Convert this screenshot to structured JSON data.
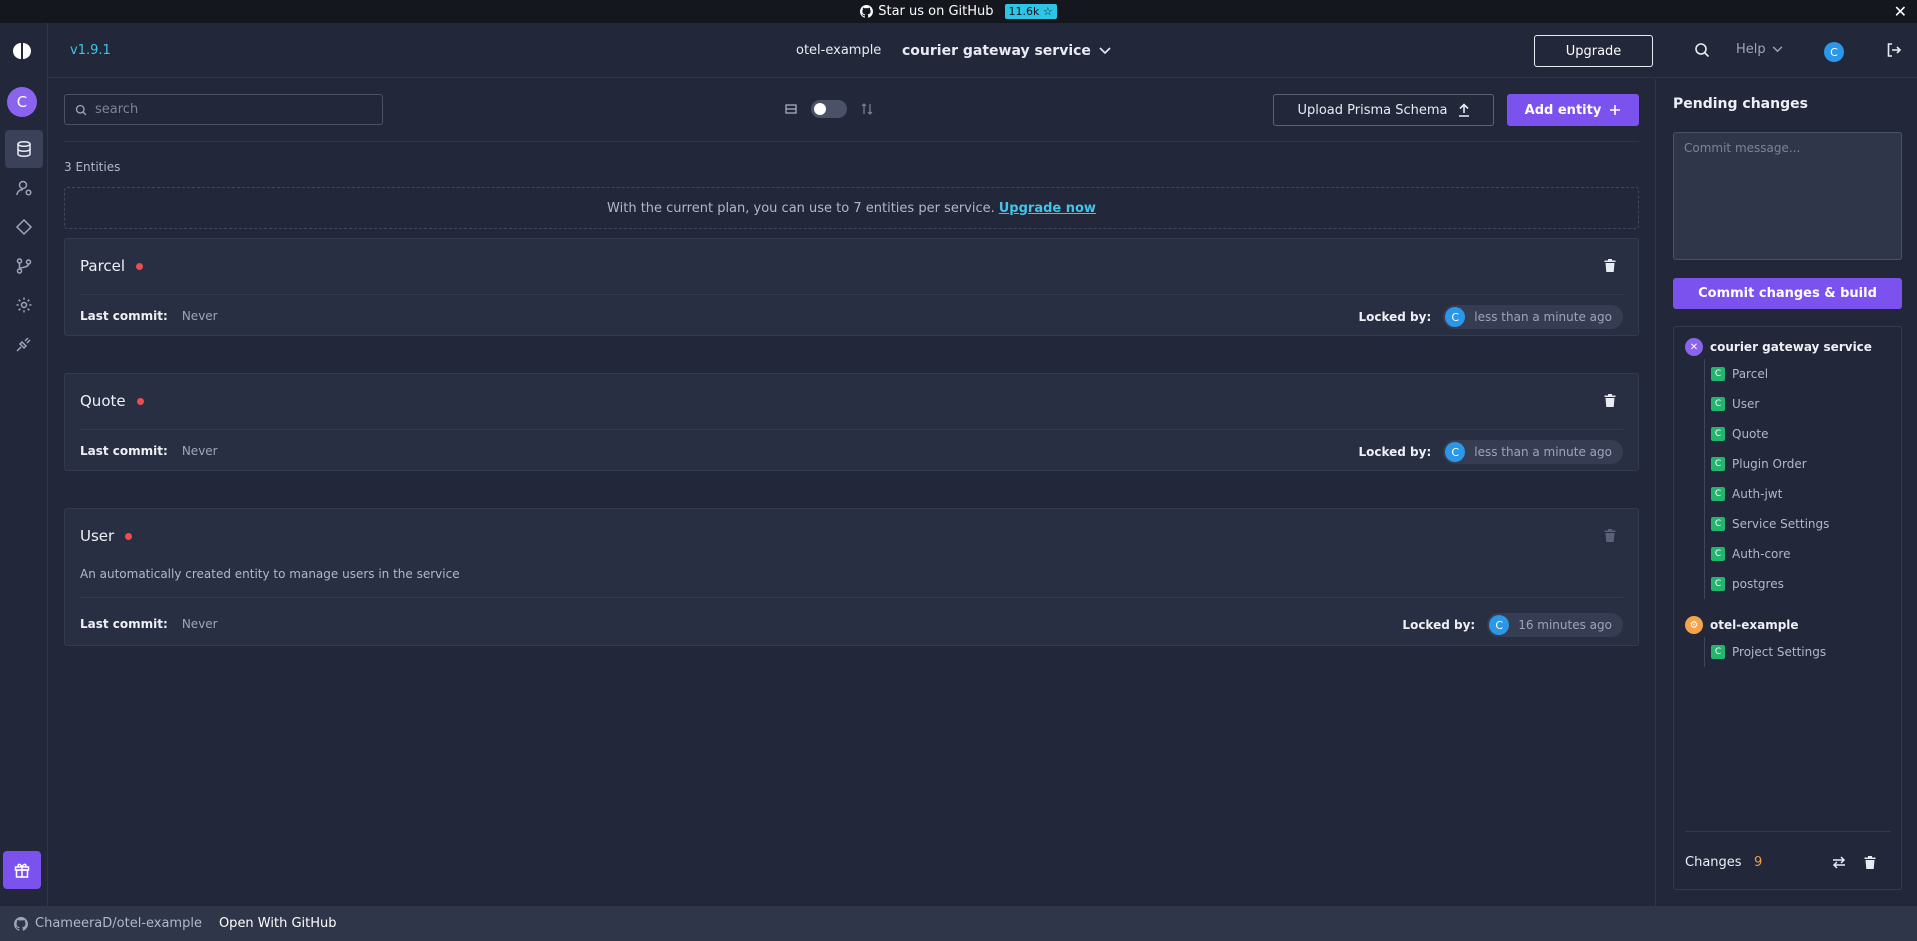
{
  "banner": {
    "text": "Star us on GitHub",
    "stars": "11.6k ☆",
    "close": "✕"
  },
  "header": {
    "version": "v1.9.1",
    "project": "otel-example",
    "service": "courier gateway service",
    "upgrade": "Upgrade",
    "help": "Help",
    "avatar_initial": "C"
  },
  "rail": {
    "avatar_initial": "C",
    "items": [
      "entities",
      "roles",
      "plugins",
      "commits",
      "settings",
      "connections"
    ]
  },
  "main": {
    "search_placeholder": "search",
    "upload_label": "Upload Prisma Schema",
    "add_label": "Add entity",
    "entity_count": "3 Entities",
    "plan_note": "With the current plan, you can use to 7 entities per service.",
    "plan_link": "Upgrade now",
    "commit_label": "Last commit:",
    "locked_label": "Locked by:",
    "entities": [
      {
        "name": "Parcel",
        "description": "",
        "last_commit": "Never",
        "locked_initial": "C",
        "locked_time": "less than a minute ago"
      },
      {
        "name": "Quote",
        "description": "",
        "last_commit": "Never",
        "locked_initial": "C",
        "locked_time": "less than a minute ago"
      },
      {
        "name": "User",
        "description": "An automatically created entity to manage users in the service",
        "last_commit": "Never",
        "locked_initial": "C",
        "locked_time": "16 minutes ago"
      }
    ]
  },
  "panel": {
    "title": "Pending changes",
    "commit_placeholder": "Commit message...",
    "commit_button": "Commit changes & build",
    "groups": [
      {
        "title": "courier gateway service",
        "color": "#8a63ef",
        "items": [
          "Parcel",
          "User",
          "Quote",
          "Plugin Order",
          "Auth-jwt",
          "Service Settings",
          "Auth-core",
          "postgres"
        ]
      },
      {
        "title": "otel-example",
        "color": "#f5a34a",
        "items": [
          "Project Settings"
        ]
      }
    ],
    "badge_letter": "C",
    "changes_label": "Changes",
    "changes_count": "9"
  },
  "bottombar": {
    "repo": "ChameeraD/otel-example",
    "open": "Open With GitHub"
  },
  "colors": {
    "accent": "#7b52ee",
    "link": "#42c3e8",
    "status_red": "#ec4d4d",
    "badge_green": "#22b56d"
  }
}
